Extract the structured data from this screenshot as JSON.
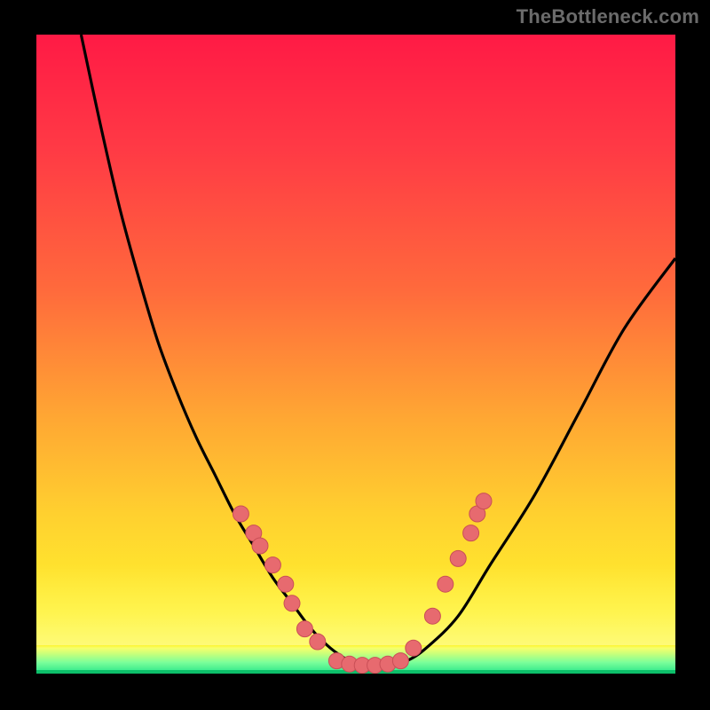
{
  "watermark": "TheBottleneck.com",
  "colors": {
    "background": "#000000",
    "gradient_top": "#ff1a45",
    "gradient_bottom": "#fdf92d",
    "green_base": "#0dbf6a",
    "curve": "#000000",
    "dot_fill": "#e76a6f",
    "dot_stroke": "#c94f56"
  },
  "chart_data": {
    "type": "line",
    "title": "",
    "xlabel": "",
    "ylabel": "",
    "xlim": [
      0,
      100
    ],
    "ylim": [
      0,
      100
    ],
    "series": [
      {
        "name": "bottleneck-curve",
        "x": [
          7,
          10,
          13,
          16,
          19,
          22,
          25,
          28,
          31,
          34,
          37,
          40,
          43,
          46,
          49,
          52,
          55,
          58,
          61,
          66,
          71,
          78,
          85,
          92,
          100
        ],
        "y": [
          100,
          86,
          73,
          62,
          52,
          44,
          37,
          31,
          25,
          20,
          15,
          11,
          7,
          4,
          2,
          1,
          1,
          2,
          4,
          9,
          17,
          28,
          41,
          54,
          65
        ]
      }
    ],
    "markers": [
      {
        "x": 32,
        "y": 25
      },
      {
        "x": 34,
        "y": 22
      },
      {
        "x": 35,
        "y": 20
      },
      {
        "x": 37,
        "y": 17
      },
      {
        "x": 39,
        "y": 14
      },
      {
        "x": 40,
        "y": 11
      },
      {
        "x": 42,
        "y": 7
      },
      {
        "x": 44,
        "y": 5
      },
      {
        "x": 47,
        "y": 2
      },
      {
        "x": 49,
        "y": 1.5
      },
      {
        "x": 51,
        "y": 1.3
      },
      {
        "x": 53,
        "y": 1.3
      },
      {
        "x": 55,
        "y": 1.5
      },
      {
        "x": 57,
        "y": 2
      },
      {
        "x": 59,
        "y": 4
      },
      {
        "x": 62,
        "y": 9
      },
      {
        "x": 64,
        "y": 14
      },
      {
        "x": 66,
        "y": 18
      },
      {
        "x": 68,
        "y": 22
      },
      {
        "x": 69,
        "y": 25
      },
      {
        "x": 70,
        "y": 27
      }
    ],
    "annotations": []
  }
}
